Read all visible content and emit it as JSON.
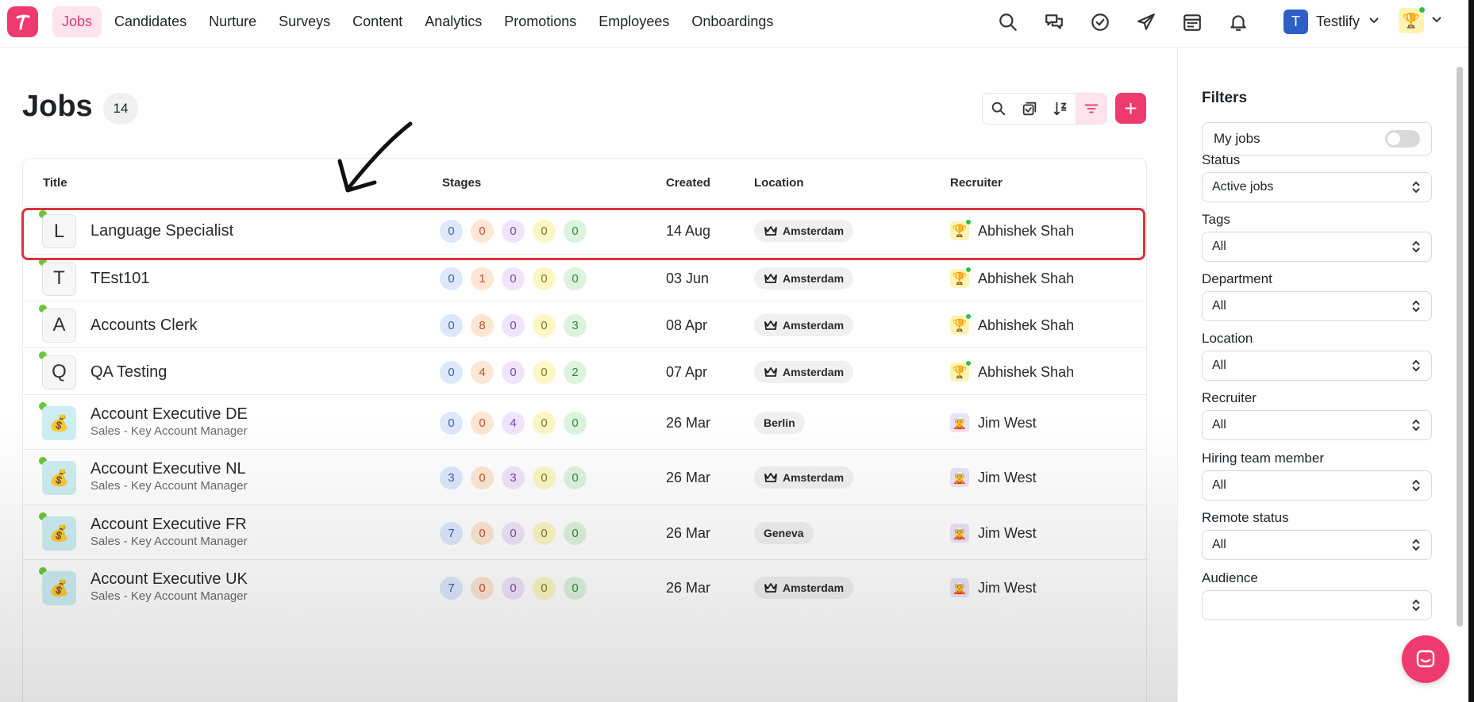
{
  "nav": {
    "items": [
      {
        "label": "Jobs",
        "active": true
      },
      {
        "label": "Candidates"
      },
      {
        "label": "Nurture"
      },
      {
        "label": "Surveys"
      },
      {
        "label": "Content"
      },
      {
        "label": "Analytics"
      },
      {
        "label": "Promotions"
      },
      {
        "label": "Employees"
      },
      {
        "label": "Onboardings"
      }
    ],
    "icons": [
      "search-icon",
      "chat-icon",
      "check-circle-icon",
      "send-icon",
      "calendar-icon",
      "bell-icon"
    ],
    "workspace": {
      "initial": "T",
      "name": "Testlify"
    },
    "accent": "#ee3a6e"
  },
  "page": {
    "title": "Jobs",
    "count": "14"
  },
  "table": {
    "headers": {
      "title": "Title",
      "stages": "Stages",
      "created": "Created",
      "location": "Location",
      "recruiter": "Recruiter"
    },
    "rows": [
      {
        "initial": "L",
        "title": "Language Specialist",
        "subtitle": "",
        "stages": [
          "0",
          "0",
          "0",
          "0",
          "0"
        ],
        "created": "14 Aug",
        "location": "Amsterdam",
        "location_icon": "crown-icon",
        "recruiter": "Abhishek Shah"
      },
      {
        "initial": "T",
        "title": "TEst101",
        "subtitle": "",
        "stages": [
          "0",
          "1",
          "0",
          "0",
          "0"
        ],
        "created": "03 Jun",
        "location": "Amsterdam",
        "location_icon": "crown-icon",
        "recruiter": "Abhishek Shah"
      },
      {
        "initial": "A",
        "title": "Accounts Clerk",
        "subtitle": "",
        "stages": [
          "0",
          "8",
          "0",
          "0",
          "3"
        ],
        "created": "08 Apr",
        "location": "Amsterdam",
        "location_icon": "crown-icon",
        "recruiter": "Abhishek Shah"
      },
      {
        "initial": "Q",
        "title": "QA Testing",
        "subtitle": "",
        "stages": [
          "0",
          "4",
          "0",
          "0",
          "2"
        ],
        "created": "07 Apr",
        "location": "Amsterdam",
        "location_icon": "crown-icon",
        "recruiter": "Abhishek Shah"
      },
      {
        "initial": "💰",
        "title": "Account Executive DE",
        "subtitle": "Sales - Key Account Manager",
        "stages": [
          "0",
          "0",
          "4",
          "0",
          "0"
        ],
        "created": "26 Mar",
        "location": "Berlin",
        "location_icon": "",
        "recruiter": "Jim West"
      },
      {
        "initial": "💰",
        "title": "Account Executive NL",
        "subtitle": "Sales - Key Account Manager",
        "stages": [
          "3",
          "0",
          "3",
          "0",
          "0"
        ],
        "created": "26 Mar",
        "location": "Amsterdam",
        "location_icon": "crown-icon",
        "recruiter": "Jim West"
      },
      {
        "initial": "💰",
        "title": "Account Executive FR",
        "subtitle": "Sales - Key Account Manager",
        "stages": [
          "7",
          "0",
          "0",
          "0",
          "0"
        ],
        "created": "26 Mar",
        "location": "Geneva",
        "location_icon": "",
        "recruiter": "Jim West"
      },
      {
        "initial": "💰",
        "title": "Account Executive UK",
        "subtitle": "Sales - Key Account Manager",
        "stages": [
          "7",
          "0",
          "0",
          "0",
          "0"
        ],
        "created": "26 Mar",
        "location": "Amsterdam",
        "location_icon": "crown-icon",
        "recruiter": "Jim West"
      }
    ]
  },
  "filters": {
    "title": "Filters",
    "my_jobs": "My jobs",
    "fields": [
      {
        "label": "Status",
        "value": "Active jobs"
      },
      {
        "label": "Tags",
        "value": "All"
      },
      {
        "label": "Department",
        "value": "All"
      },
      {
        "label": "Location",
        "value": "All"
      },
      {
        "label": "Recruiter",
        "value": "All"
      },
      {
        "label": "Hiring team member",
        "value": "All"
      },
      {
        "label": "Remote status",
        "value": "All"
      },
      {
        "label": "Audience",
        "value": ""
      }
    ]
  }
}
